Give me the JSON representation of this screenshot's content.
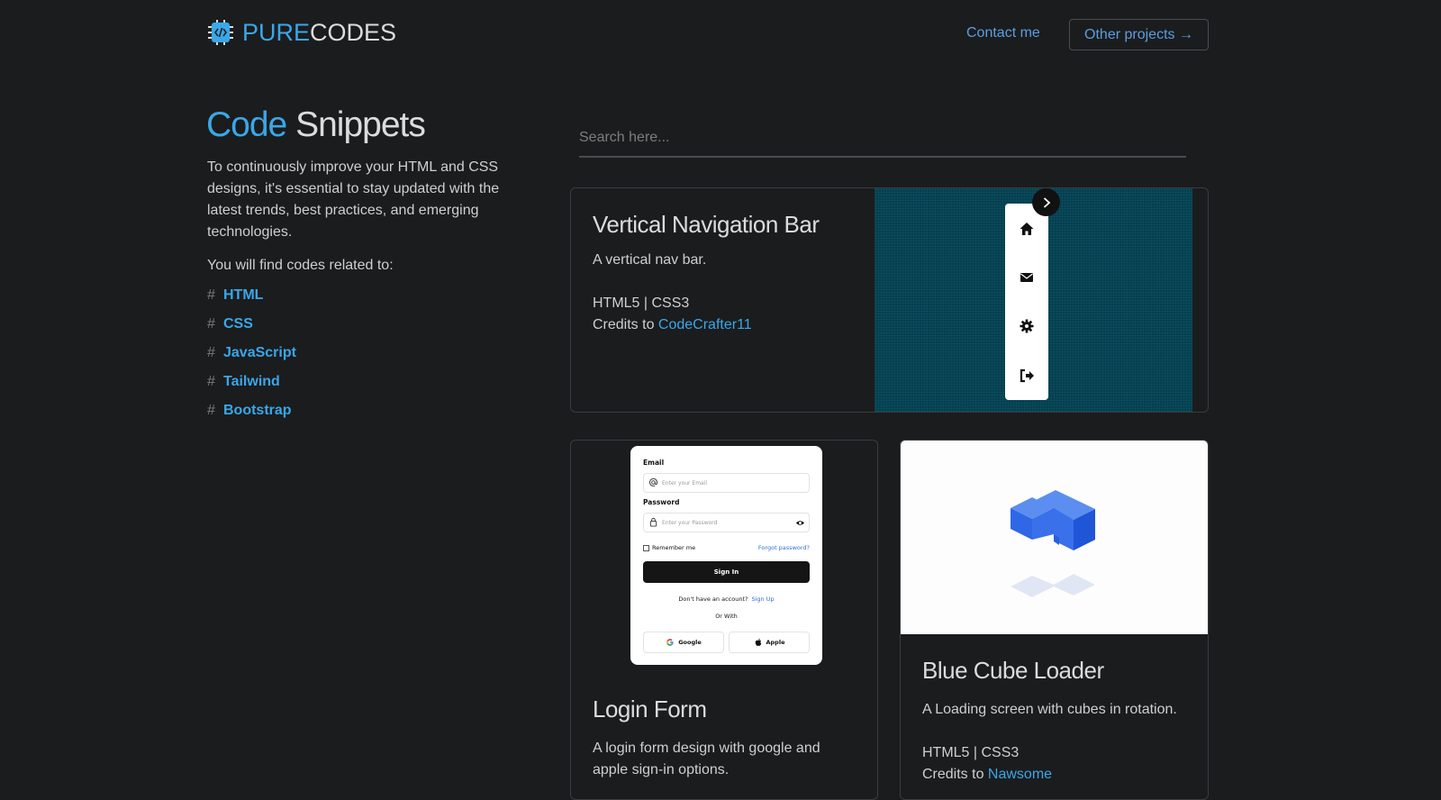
{
  "brand": {
    "name_part1": "PURE",
    "name_part2": "CODES",
    "icon": "code-chip-icon",
    "accent_color": "#3aa7e8"
  },
  "nav": {
    "contact_label": "Contact me",
    "other_projects_label": "Other projects →"
  },
  "hero": {
    "title_accent": "Code",
    "title_rest": "Snippets",
    "description": "To continuously improve your HTML and CSS designs, it's essential to stay updated with the latest trends, best practices, and emerging technologies.",
    "related_label": "You will find codes related to:",
    "topic_prefix": "#",
    "topics": [
      "HTML",
      "CSS",
      "JavaScript",
      "Tailwind",
      "Bootstrap"
    ]
  },
  "search": {
    "placeholder": "Search here..."
  },
  "cards": [
    {
      "title": "Vertical Navigation Bar",
      "description": "A vertical nav bar.",
      "tech": "HTML5 | CSS3",
      "credits_prefix": "Credits to ",
      "author": "CodeCrafter11",
      "preview_icons": [
        "home-icon",
        "mail-icon",
        "gear-icon",
        "logout-icon",
        "chevron-right-icon"
      ]
    },
    {
      "title": "Login Form",
      "description": "A login form design with google and apple sign-in options.",
      "preview": {
        "email_label": "Email",
        "email_placeholder": "Enter your Email",
        "password_label": "Password",
        "password_placeholder": "Enter your Password",
        "remember_label": "Remember me",
        "forgot_label": "Forgot password?",
        "signin_label": "Sign In",
        "no_account_label": "Don't have an account?",
        "signup_label": "Sign Up",
        "or_with_label": "Or With",
        "google_label": "Google",
        "apple_label": "Apple"
      }
    },
    {
      "title": "Blue Cube Loader",
      "description": "A Loading screen with cubes in rotation.",
      "tech": "HTML5 | CSS3",
      "credits_prefix": "Credits to ",
      "author": "Nawsome"
    }
  ]
}
